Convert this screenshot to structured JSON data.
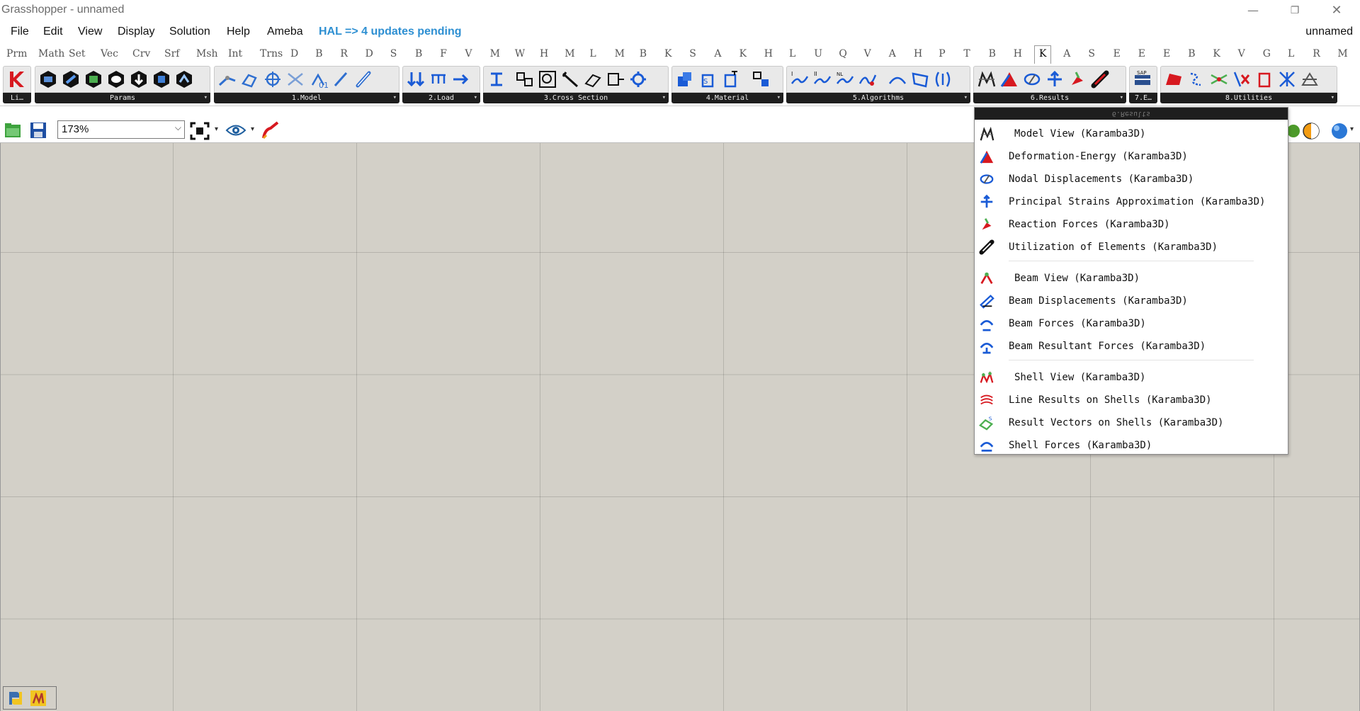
{
  "window": {
    "title": "Grasshopper - unnamed"
  },
  "menubar": {
    "items": [
      "File",
      "Edit",
      "View",
      "Display",
      "Solution",
      "Help",
      "Ameba"
    ],
    "hal_notice": "HAL => 4 updates pending",
    "document": "unnamed"
  },
  "tabs": [
    "Prm",
    "Math",
    "Set",
    "Vec",
    "Crv",
    "Srf",
    "Msh",
    "Int",
    "Trns",
    "D",
    "B",
    "R",
    "D",
    "S",
    "B",
    "F",
    "V",
    "M",
    "W",
    "H",
    "M",
    "L",
    "M",
    "B",
    "K",
    "S",
    "A",
    "K",
    "H",
    "L",
    "U",
    "Q",
    "V",
    "A",
    "H",
    "P",
    "T",
    "B",
    "H",
    "K",
    "A",
    "S",
    "E",
    "E",
    "E",
    "B",
    "K",
    "V",
    "G",
    "L",
    "R",
    "M"
  ],
  "active_tab_index": 39,
  "panels": [
    {
      "label": "Li…"
    },
    {
      "label": "Params"
    },
    {
      "label": "1.Model"
    },
    {
      "label": "2.Load"
    },
    {
      "label": "3.Cross Section"
    },
    {
      "label": "4.Material"
    },
    {
      "label": "5.Algorithms"
    },
    {
      "label": "6.Results"
    },
    {
      "label": "7.E…"
    },
    {
      "label": "8.Utilities"
    }
  ],
  "canvas_toolbar": {
    "zoom": "173%"
  },
  "dropdown": {
    "header": "6.Results",
    "items": [
      {
        "label": "Model View (Karamba3D)",
        "icon": "model-view-icon"
      },
      {
        "label": "Deformation-Energy (Karamba3D)",
        "icon": "deformation-energy-icon"
      },
      {
        "label": "Nodal Displacements (Karamba3D)",
        "icon": "nodal-displacements-icon"
      },
      {
        "label": "Principal Strains Approximation (Karamba3D)",
        "icon": "principal-strains-icon"
      },
      {
        "label": "Reaction Forces (Karamba3D)",
        "icon": "reaction-forces-icon"
      },
      {
        "label": "Utilization of Elements (Karamba3D)",
        "icon": "utilization-icon"
      },
      {
        "label": "Beam View (Karamba3D)",
        "icon": "beam-view-icon"
      },
      {
        "label": "Beam Displacements (Karamba3D)",
        "icon": "beam-displacements-icon"
      },
      {
        "label": "Beam Forces (Karamba3D)",
        "icon": "beam-forces-icon"
      },
      {
        "label": "Beam Resultant Forces (Karamba3D)",
        "icon": "beam-resultant-forces-icon"
      },
      {
        "label": "Shell View (Karamba3D)",
        "icon": "shell-view-icon"
      },
      {
        "label": "Line Results on Shells (Karamba3D)",
        "icon": "line-results-shells-icon"
      },
      {
        "label": "Result Vectors on Shells (Karamba3D)",
        "icon": "result-vectors-shells-icon"
      },
      {
        "label": "Shell Forces (Karamba3D)",
        "icon": "shell-forces-icon"
      }
    ]
  },
  "colors": {
    "canvas": "#d3d0c8",
    "hal": "#2d8fd2",
    "panel_label_bg": "#1e1e1e"
  }
}
